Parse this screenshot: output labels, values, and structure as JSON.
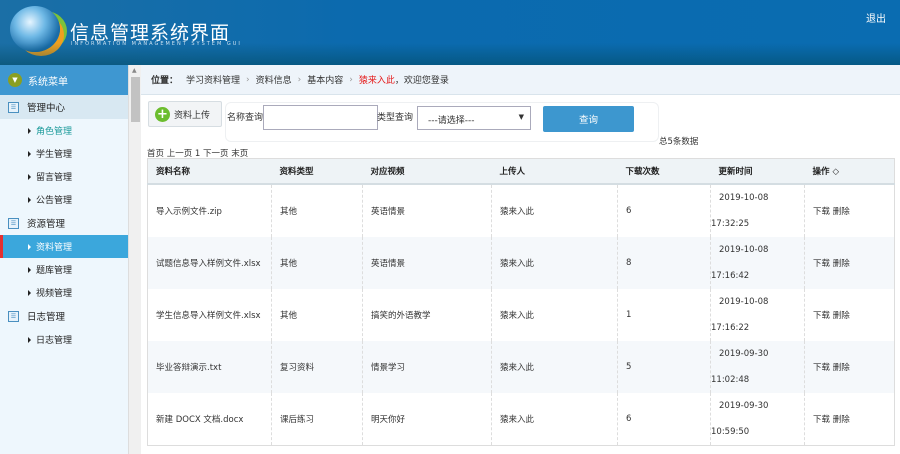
{
  "header": {
    "title": "信息管理系统界面",
    "subtitle": "INFORMATION MANAGEMENT SYSTEM GUI",
    "logout": "退出"
  },
  "sidebar": {
    "title": "系统菜单",
    "groups": [
      {
        "label": "管理中心",
        "items": [
          "角色管理",
          "学生管理",
          "留言管理",
          "公告管理"
        ]
      },
      {
        "label": "资源管理",
        "items": [
          "资料管理",
          "题库管理",
          "视频管理"
        ]
      },
      {
        "label": "日志管理",
        "items": [
          "日志管理"
        ]
      }
    ]
  },
  "breadcrumb": {
    "label": "位置：",
    "items": [
      "学习资料管理",
      "资料信息",
      "基本内容"
    ],
    "user": "猿来入此",
    "welcome": "，欢迎您登录"
  },
  "toolbar": {
    "upload": "资料上传",
    "name_label": "名称查询",
    "name_value": "",
    "type_label": "类型查询",
    "type_value": "---请选择---",
    "query": "查询",
    "total": "总5条数据"
  },
  "pager": "首页 上一页 1 下一页 末页",
  "table": {
    "headers": [
      "资料名称",
      "资料类型",
      "对应视频",
      "上传人",
      "下载次数",
      "更新时间",
      "操作 ◇"
    ],
    "rows": [
      {
        "name": "导入示例文件.zip",
        "type": "其他",
        "video": "英语情景",
        "uploader": "猿来入此",
        "downloads": "6",
        "date": "2019-10-08",
        "time": "17:32:25"
      },
      {
        "name": "试题信息导入样例文件.xlsx",
        "type": "其他",
        "video": "英语情景",
        "uploader": "猿来入此",
        "downloads": "8",
        "date": "2019-10-08",
        "time": "17:16:42"
      },
      {
        "name": "学生信息导入样例文件.xlsx",
        "type": "其他",
        "video": "搞笑的外语教学",
        "uploader": "猿来入此",
        "downloads": "1",
        "date": "2019-10-08",
        "time": "17:16:22"
      },
      {
        "name": "毕业答辩演示.txt",
        "type": "复习资料",
        "video": "情景学习",
        "uploader": "猿来入此",
        "downloads": "5",
        "date": "2019-09-30",
        "time": "11:02:48"
      },
      {
        "name": "新建 DOCX 文档.docx",
        "type": "课后练习",
        "video": "明天你好",
        "uploader": "猿来入此",
        "downloads": "6",
        "date": "2019-09-30",
        "time": "10:59:50"
      }
    ],
    "actions": {
      "download": "下载",
      "delete": "删除"
    }
  }
}
